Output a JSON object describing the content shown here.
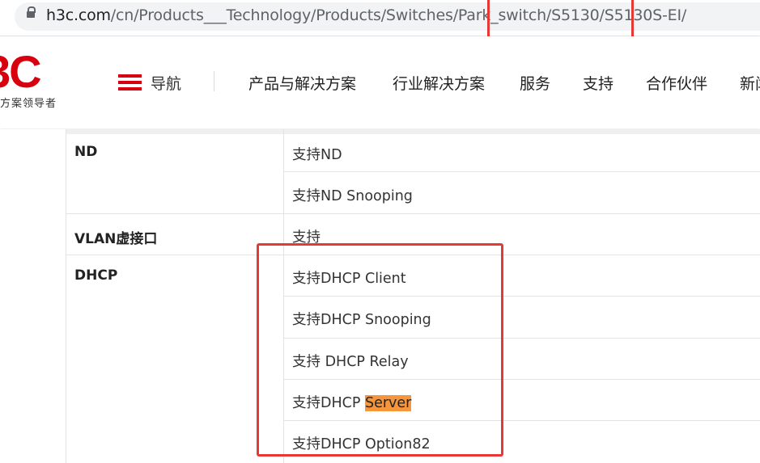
{
  "address_bar": {
    "host": "h3c.com",
    "path": "/cn/Products___Technology/Products/Switches/Park_switch/S5130/S5130S-EI/"
  },
  "header": {
    "logo_text": "3C",
    "logo_slogan": "方案领导者",
    "nav_toggle_label": "导航",
    "nav_items": [
      "产品与解决方案",
      "行业解决方案",
      "服务",
      "支持",
      "合作伙伴",
      "新闻"
    ]
  },
  "spec_table": {
    "rows": [
      {
        "feature": "ND",
        "values": [
          "支持ND",
          "支持ND Snooping"
        ]
      },
      {
        "feature": "VLAN虚接口",
        "values": [
          "支持"
        ]
      },
      {
        "feature": "DHCP",
        "values": [
          "支持DHCP Client",
          "支持DHCP Snooping",
          "支持 DHCP Relay",
          "支持DHCP ",
          "支持DHCP Option82"
        ]
      }
    ],
    "highlight": "Server"
  },
  "colors": {
    "brand_red": "#d7000f",
    "annotation_red": "#e53935",
    "highlight_orange": "#f5953c"
  }
}
